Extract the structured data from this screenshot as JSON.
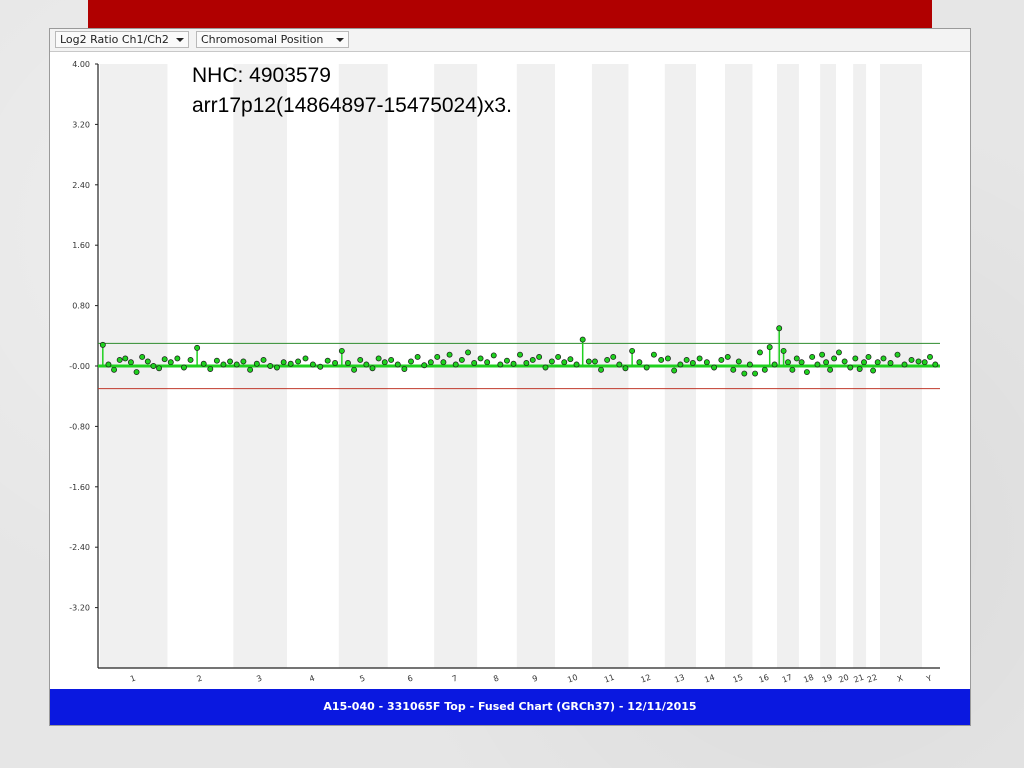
{
  "toolbar": {
    "measure_select": "Log2 Ratio Ch1/Ch2",
    "position_select": "Chromosomal Position"
  },
  "footer": {
    "caption": "A15-040 - 331065F Top  - Fused Chart (GRCh37) - 12/11/2015"
  },
  "colors": {
    "slide_accent": "#b00000",
    "footer_bar": "#0a18e0",
    "data_points": "#1fd11f",
    "upper_threshold": "#2e8b2e",
    "lower_threshold": "#c0392b"
  },
  "chart_data": {
    "type": "scatter",
    "title": "",
    "xlabel": "",
    "ylabel": "",
    "ylim": [
      -4.0,
      4.0
    ],
    "y_ticks": [
      "4.00",
      "3.20",
      "2.40",
      "1.60",
      "0.80",
      "-0.00",
      "-0.80",
      "-1.60",
      "-2.40",
      "-3.20"
    ],
    "chromosomes": [
      "1",
      "2",
      "3",
      "4",
      "5",
      "6",
      "7",
      "8",
      "9",
      "10",
      "11",
      "12",
      "13",
      "14",
      "15",
      "16",
      "17",
      "18",
      "19",
      "20",
      "21",
      "22",
      "X",
      "Y"
    ],
    "thresholds": {
      "upper": 0.3,
      "lower": -0.3
    },
    "annotation": [
      "NHC: 4903579",
      "arr17p12(14864897-15475024)x3."
    ],
    "series": [
      {
        "values": [
          {
            "chromosome": "1",
            "points": [
              0.28,
              0.02,
              -0.05,
              0.08,
              0.1,
              0.05,
              -0.08,
              0.12,
              0.06,
              0.0,
              -0.03,
              0.09
            ]
          },
          {
            "chromosome": "2",
            "points": [
              0.05,
              0.1,
              -0.02,
              0.08,
              0.24,
              0.03,
              -0.04,
              0.07,
              0.02,
              0.06
            ]
          },
          {
            "chromosome": "3",
            "points": [
              0.02,
              0.06,
              -0.05,
              0.03,
              0.08,
              0.0,
              -0.02,
              0.05
            ]
          },
          {
            "chromosome": "4",
            "points": [
              0.03,
              0.06,
              0.1,
              0.02,
              -0.01,
              0.07,
              0.04
            ]
          },
          {
            "chromosome": "5",
            "points": [
              0.2,
              0.04,
              -0.05,
              0.08,
              0.02,
              -0.03,
              0.1,
              0.05
            ]
          },
          {
            "chromosome": "6",
            "points": [
              0.08,
              0.02,
              -0.04,
              0.06,
              0.12,
              0.01,
              0.05
            ]
          },
          {
            "chromosome": "7",
            "points": [
              0.12,
              0.05,
              0.15,
              0.02,
              0.08,
              0.18,
              0.04
            ]
          },
          {
            "chromosome": "8",
            "points": [
              0.1,
              0.05,
              0.14,
              0.02,
              0.07,
              0.03
            ]
          },
          {
            "chromosome": "9",
            "points": [
              0.15,
              0.04,
              0.08,
              0.12,
              -0.02,
              0.06
            ]
          },
          {
            "chromosome": "10",
            "points": [
              0.12,
              0.05,
              0.09,
              0.02,
              0.35,
              0.06
            ]
          },
          {
            "chromosome": "11",
            "points": [
              0.06,
              -0.05,
              0.08,
              0.12,
              0.02,
              -0.03
            ]
          },
          {
            "chromosome": "12",
            "points": [
              0.2,
              0.05,
              -0.02,
              0.15,
              0.08
            ]
          },
          {
            "chromosome": "13",
            "points": [
              0.1,
              -0.06,
              0.02,
              0.08,
              0.04
            ]
          },
          {
            "chromosome": "14",
            "points": [
              0.1,
              0.05,
              -0.02,
              0.08
            ]
          },
          {
            "chromosome": "15",
            "points": [
              0.12,
              -0.05,
              0.06,
              -0.1,
              0.02
            ]
          },
          {
            "chromosome": "16",
            "points": [
              -0.1,
              0.18,
              -0.05,
              0.25,
              0.02
            ]
          },
          {
            "chromosome": "17",
            "points": [
              0.5,
              0.2,
              0.05,
              -0.05,
              0.1
            ]
          },
          {
            "chromosome": "18",
            "points": [
              0.05,
              -0.08,
              0.12,
              0.02
            ]
          },
          {
            "chromosome": "19",
            "points": [
              0.15,
              0.05,
              -0.05,
              0.1
            ]
          },
          {
            "chromosome": "20",
            "points": [
              0.18,
              0.06,
              -0.02
            ]
          },
          {
            "chromosome": "21",
            "points": [
              0.1,
              -0.04,
              0.05
            ]
          },
          {
            "chromosome": "22",
            "points": [
              0.12,
              -0.06,
              0.05
            ]
          },
          {
            "chromosome": "X",
            "points": [
              0.1,
              0.04,
              0.15,
              0.02,
              0.08,
              0.06
            ]
          },
          {
            "chromosome": "Y",
            "points": [
              0.05,
              0.12,
              0.02
            ]
          }
        ]
      }
    ]
  }
}
